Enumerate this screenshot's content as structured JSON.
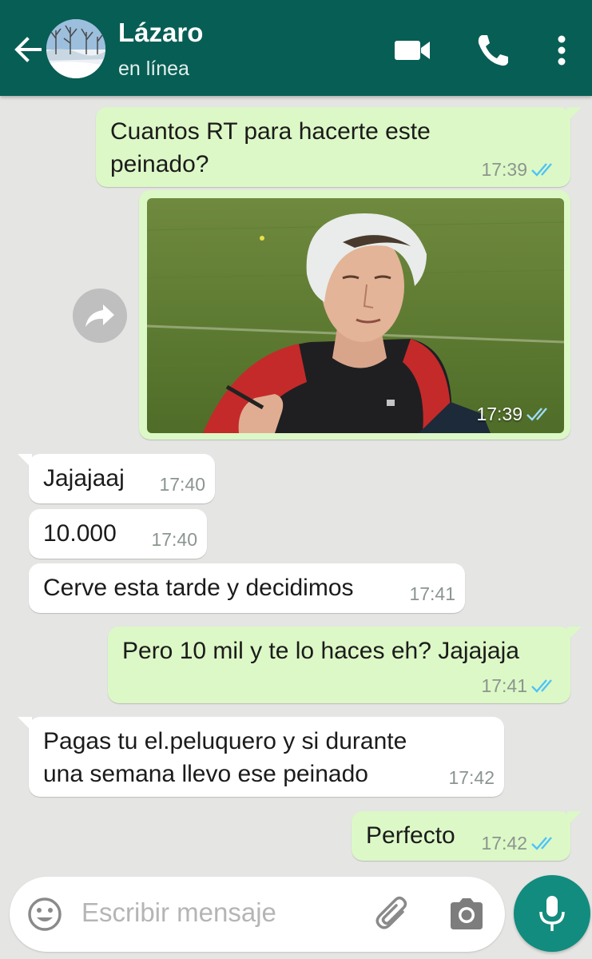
{
  "header": {
    "contact_name": "Lázaro",
    "status": "en línea"
  },
  "messages": [
    {
      "direction": "out",
      "text": "Cuantos RT para hacerte este\npeinado?",
      "time": "17:39",
      "read": true
    },
    {
      "direction": "out",
      "type": "image",
      "time": "17:39",
      "read": true
    },
    {
      "direction": "in",
      "text": "Jajajaaj",
      "time": "17:40"
    },
    {
      "direction": "in",
      "text": "10.000",
      "time": "17:40"
    },
    {
      "direction": "in",
      "text": "Cerve esta tarde y decidimos",
      "time": "17:41"
    },
    {
      "direction": "out",
      "text": "Pero 10 mil y te lo haces eh? Jajajaja",
      "time": "17:41",
      "read": true
    },
    {
      "direction": "in",
      "text": "Pagas tu el.peluquero y si durante\nuna semana llevo ese peinado",
      "time": "17:42"
    },
    {
      "direction": "out",
      "text": "Perfecto",
      "time": "17:42",
      "read": true
    }
  ],
  "composer": {
    "placeholder": "Escribir mensaje"
  },
  "icons": {
    "back": "arrow-left-icon",
    "video": "video-call-icon",
    "call": "phone-icon",
    "menu": "more-vert-icon",
    "share": "forward-icon",
    "emoji": "emoji-icon",
    "attach": "paperclip-icon",
    "camera": "camera-icon",
    "mic": "microphone-icon"
  },
  "colors": {
    "header": "#075e54",
    "outgoing_bubble": "#dcf8c6",
    "incoming_bubble": "#ffffff",
    "read_ticks": "#4fc3f7",
    "mic_button": "#128c7e",
    "background": "#e5e5e3"
  }
}
